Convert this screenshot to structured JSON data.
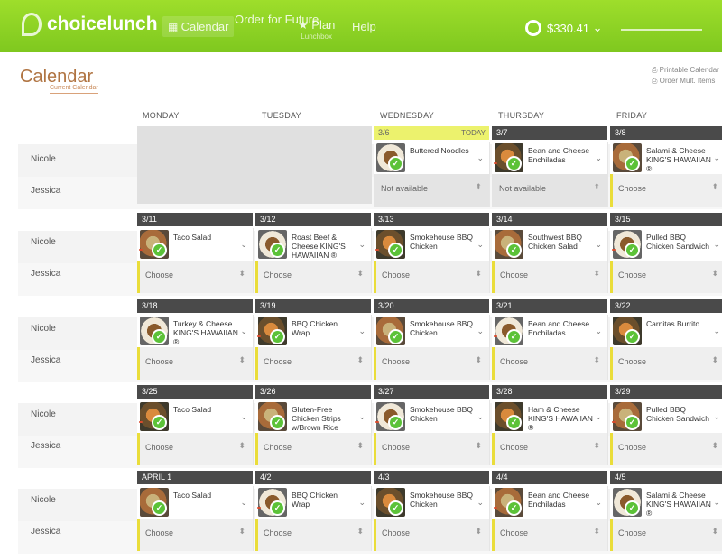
{
  "app": {
    "logo": "choicelunch",
    "nav": [
      {
        "label": "Calendar",
        "sub": ""
      },
      {
        "label": "Order for Future",
        "sub": ""
      },
      {
        "label": "Plan",
        "sub": "Lunchbox"
      },
      {
        "label": "Help",
        "sub": ""
      }
    ],
    "balance": "$330.41",
    "account_name": ""
  },
  "page": {
    "title": "Calendar",
    "subtitle": "Current Calendar",
    "links": [
      "Printable Calendar",
      "Order Mult. Items"
    ]
  },
  "days": [
    "MONDAY",
    "TUESDAY",
    "WEDNESDAY",
    "THURSDAY",
    "FRIDAY"
  ],
  "rows": [
    "Nicole",
    "Jessica"
  ],
  "weeks": [
    {
      "dates": [
        "",
        "",
        "3/6",
        "3/7",
        "3/8"
      ],
      "today_label": "TODAY",
      "nicole": [
        "",
        "",
        "Buttered Noodles",
        "Bean and Cheese Enchiladas",
        "Salami & Cheese KING'S HAWAIIAN ®"
      ],
      "jessica": [
        "",
        "",
        "Not available",
        "Not available",
        "Choose"
      ]
    },
    {
      "dates": [
        "3/11",
        "3/12",
        "3/13",
        "3/14",
        "3/15"
      ],
      "nicole": [
        "Taco Salad",
        "Roast Beef & Cheese KING'S HAWAIIAN ®",
        "Smokehouse BBQ Chicken",
        "Southwest BBQ Chicken Salad",
        "Pulled BBQ Chicken Sandwich"
      ],
      "jessica": [
        "Choose",
        "Choose",
        "Choose",
        "Choose",
        "Choose"
      ]
    },
    {
      "dates": [
        "3/18",
        "3/19",
        "3/20",
        "3/21",
        "3/22"
      ],
      "nicole": [
        "Turkey & Cheese KING'S HAWAIIAN ®",
        "BBQ Chicken Wrap",
        "Smokehouse BBQ Chicken",
        "Bean and Cheese Enchiladas",
        "Carnitas Burrito"
      ],
      "jessica": [
        "Choose",
        "Choose",
        "Choose",
        "Choose",
        "Choose"
      ]
    },
    {
      "dates": [
        "3/25",
        "3/26",
        "3/27",
        "3/28",
        "3/29"
      ],
      "nicole": [
        "Taco Salad",
        "Gluten-Free Chicken Strips w/Brown Rice",
        "Smokehouse BBQ Chicken",
        "Ham & Cheese KING'S HAWAIIAN ®",
        "Pulled BBQ Chicken Sandwich"
      ],
      "jessica": [
        "Choose",
        "Choose",
        "Choose",
        "Choose",
        "Choose"
      ]
    },
    {
      "dates": [
        "APRIL 1",
        "4/2",
        "4/3",
        "4/4",
        "4/5"
      ],
      "nicole": [
        "Taco Salad",
        "BBQ Chicken Wrap",
        "Smokehouse BBQ Chicken",
        "Bean and Cheese Enchiladas",
        "Salami & Cheese KING'S HAWAIIAN ®"
      ],
      "jessica": [
        "Choose",
        "Choose",
        "Choose",
        "Choose",
        "Choose"
      ]
    }
  ],
  "colors": {
    "brand": "#8fd325",
    "today": "#ecf26d",
    "datebar": "#4a4a4a",
    "check": "#5cc238",
    "title": "#b07442"
  }
}
